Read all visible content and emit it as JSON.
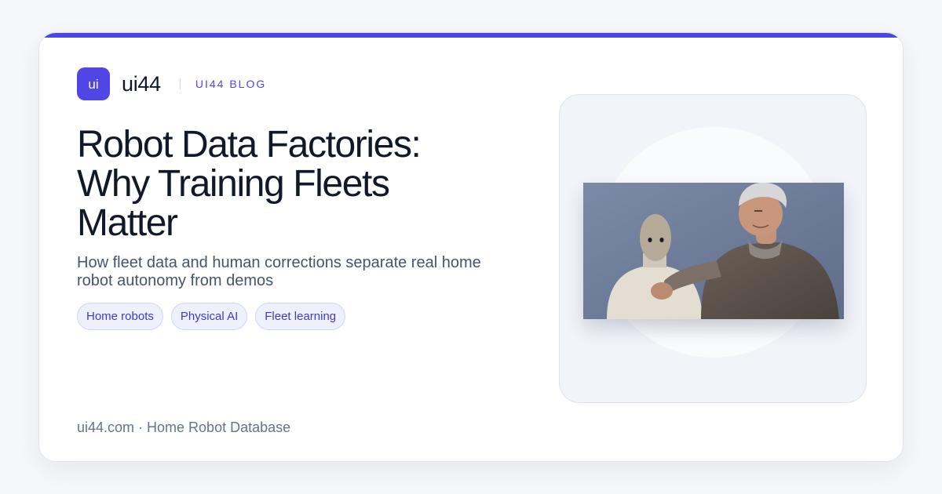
{
  "brand": {
    "logo_text": "ui",
    "name": "ui44",
    "section_label": "UI44 BLOG",
    "accent_color": "#4f46e5"
  },
  "article": {
    "title": "Robot Data Factories: Why Training Fleets Matter",
    "subtitle": "How fleet data and human corrections separate real home robot autonomy from demos",
    "tags": [
      "Home robots",
      "Physical AI",
      "Fleet learning"
    ]
  },
  "footer": {
    "text": "ui44.com · Home Robot Database"
  }
}
